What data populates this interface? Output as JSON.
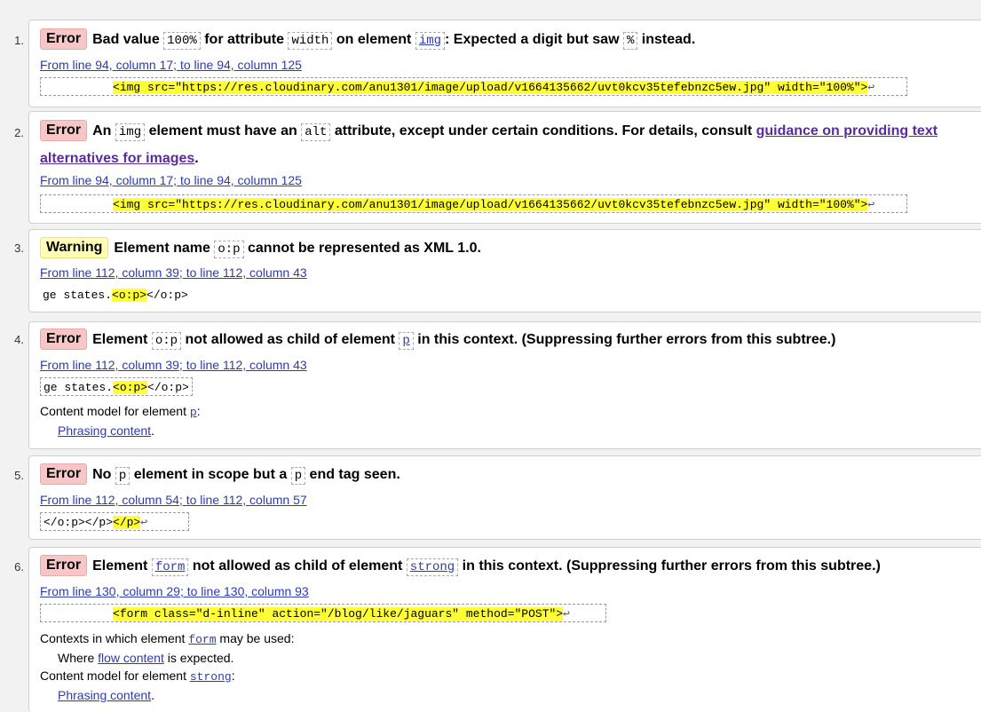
{
  "messages": [
    {
      "number": "1.",
      "type": "Error",
      "parts": [
        "Bad value ",
        "100%",
        " for attribute ",
        "width",
        " on element ",
        "img",
        ": Expected a digit but saw ",
        "%",
        " instead."
      ],
      "location": "From line 94, column 17; to line 94, column 125",
      "extract_pre": "          ",
      "extract_hl": "<img src=\"https://res.cloudinary.com/anu1301/image/upload/v1664135662/uvt0kcv35tefebnzc5ew.jpg\" width=\"100%\">",
      "extract_post": "",
      "return_mark": "↩"
    },
    {
      "number": "2.",
      "type": "Error",
      "parts": [
        "An ",
        "img",
        " element must have an ",
        "alt",
        " attribute, except under certain conditions. For details, consult "
      ],
      "guidance_line1": "guidance on providing text",
      "guidance_line2": "alternatives for images",
      "location": "From line 94, column 17; to line 94, column 125",
      "extract_pre": "          ",
      "extract_hl": "<img src=\"https://res.cloudinary.com/anu1301/image/upload/v1664135662/uvt0kcv35tefebnzc5ew.jpg\" width=\"100%\">",
      "return_mark": "↩"
    },
    {
      "number": "3.",
      "type": "Warning",
      "parts": [
        "Element name ",
        "o:p",
        " cannot be represented as XML 1.0."
      ],
      "location": "From line 112, column 39; to line 112, column 43",
      "extract_pre": "ge states.",
      "extract_hl": "<o:p>",
      "extract_post": "</o:p>"
    },
    {
      "number": "4.",
      "type": "Error",
      "parts": [
        "Element ",
        "o:p",
        " not allowed as child of element ",
        "p",
        " in this context. (Suppressing further errors from this subtree.)"
      ],
      "location": "From line 112, column 39; to line 112, column 43",
      "extract_pre": "ge states.",
      "extract_hl": "<o:p>",
      "extract_post": "</o:p>",
      "note1_pre": "Content model for element ",
      "note1_code": "p",
      "note1_post": ":",
      "note2_link": "Phrasing content",
      "note2_post": "."
    },
    {
      "number": "5.",
      "type": "Error",
      "parts": [
        "No ",
        "p",
        " element in scope but a ",
        "p",
        " end tag seen."
      ],
      "location": "From line 112, column 54; to line 112, column 57",
      "extract_pre": "</o:p></p>",
      "extract_hl": "</p>",
      "return_mark": "↩"
    },
    {
      "number": "6.",
      "type": "Error",
      "parts": [
        "Element ",
        "form",
        " not allowed as child of element ",
        "strong",
        " in this context. (Suppressing further errors from this subtree.)"
      ],
      "location": "From line 130, column 29; to line 130, column 93",
      "extract_pre": "          ",
      "extract_hl": "<form class=\"d-inline\" action=\"/blog/like/jaguars\" method=\"POST\">",
      "return_mark": "↩",
      "note1_pre": "Contexts in which element ",
      "note1_code": "form",
      "note1_post": " may be used:",
      "note2_pre": "Where ",
      "note2_link": "flow content",
      "note2_post": " is expected.",
      "note3_pre": "Content model for element ",
      "note3_code": "strong",
      "note3_post": ":",
      "note4_link": "Phrasing content",
      "note4_post": "."
    }
  ]
}
